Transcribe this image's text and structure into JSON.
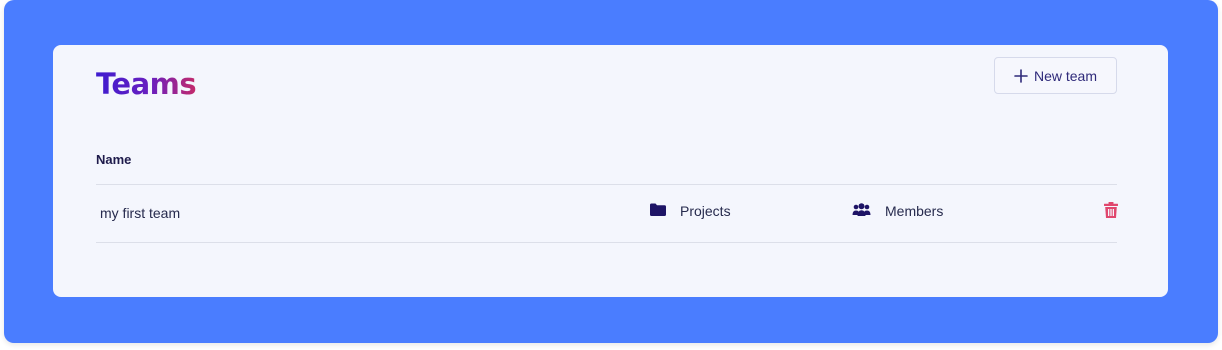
{
  "page": {
    "title": "Teams",
    "new_team_label": "New team"
  },
  "table": {
    "columns": [
      "Name"
    ],
    "rows": [
      {
        "name": "my first team",
        "projects_label": "Projects",
        "members_label": "Members"
      }
    ]
  },
  "icons": {
    "new_team": "plus-icon",
    "projects": "folder-icon",
    "members": "users-icon",
    "delete": "trash-icon"
  },
  "colors": {
    "background": "#4a7dff",
    "card": "#f4f6fd",
    "title_gradient_start": "#3e1ccf",
    "title_gradient_end": "#c42a6a",
    "icon_dark": "#1e1466",
    "delete": "#e0476e"
  }
}
